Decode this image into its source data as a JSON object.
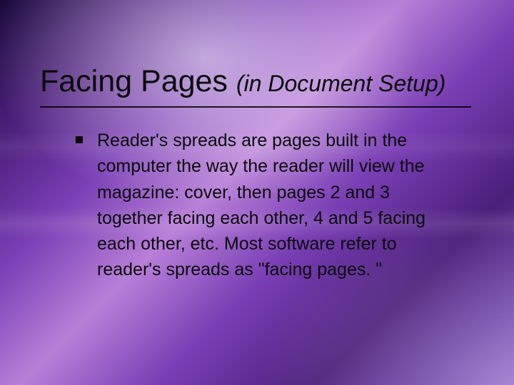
{
  "slide": {
    "title_main": "Facing Pages",
    "title_sub": "(in Document Setup)",
    "bullets": [
      "Reader's spreads are pages built in the computer the way the reader will view the magazine: cover, then pages 2 and 3 together facing each other, 4 and 5 facing each other, etc. Most software refer to reader's spreads as \"facing pages. \""
    ]
  }
}
